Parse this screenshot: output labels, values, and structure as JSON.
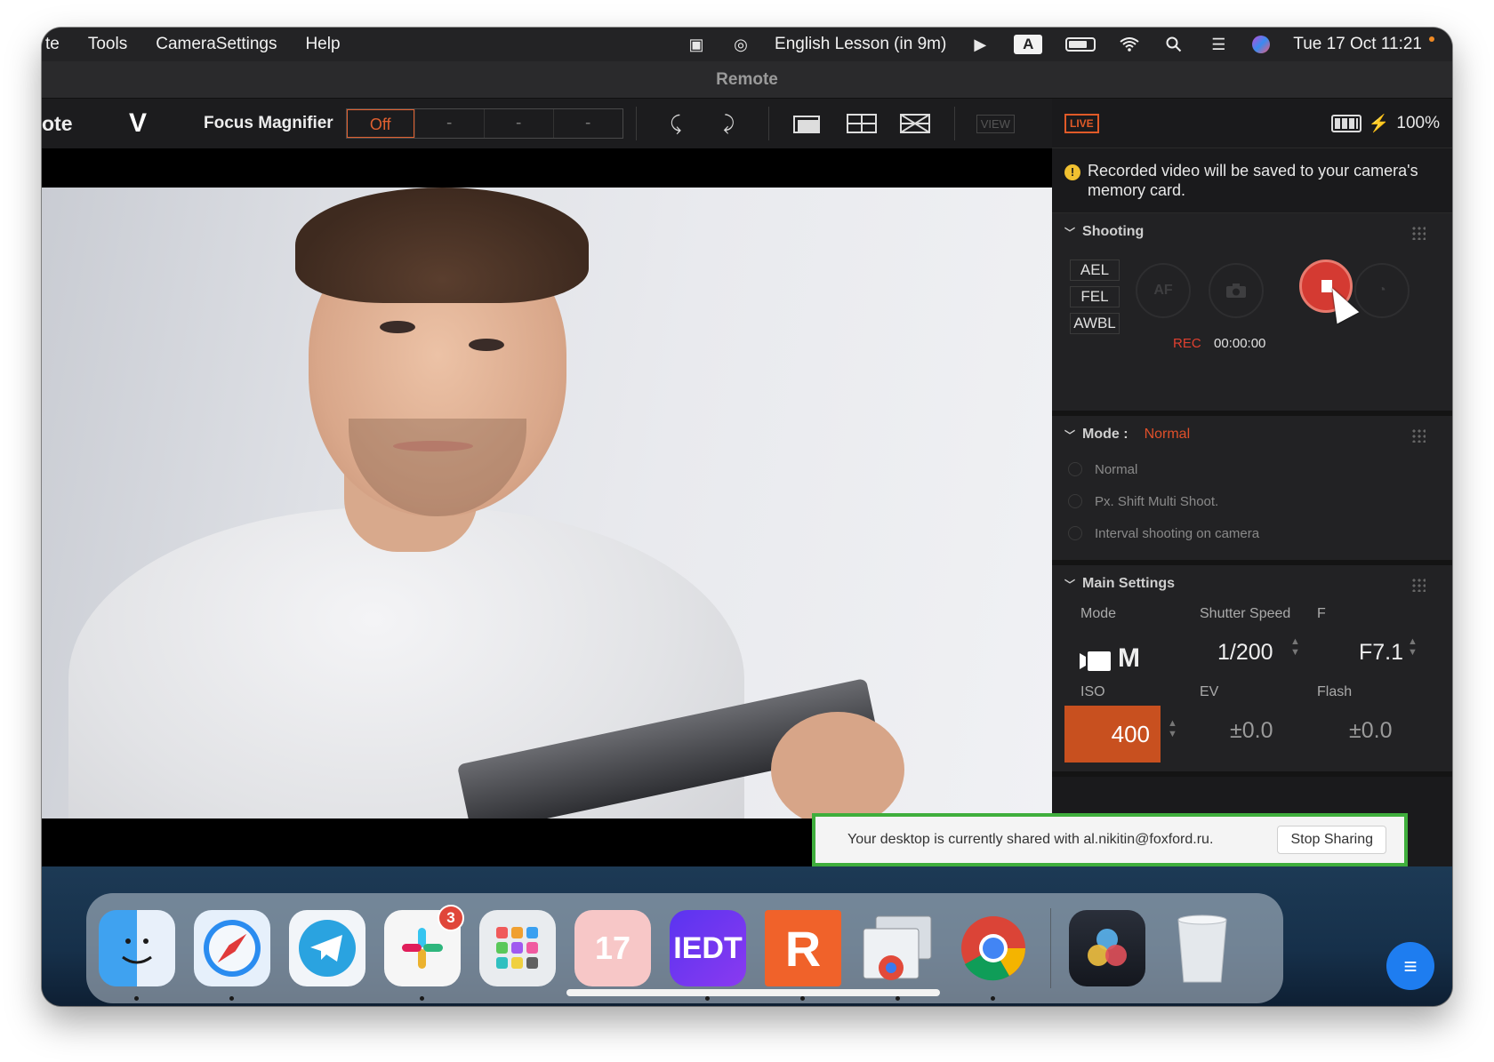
{
  "menubar": {
    "app_fragment": "te",
    "items": [
      "Tools",
      "CameraSettings",
      "Help"
    ],
    "event": "English Lesson (in 9m)",
    "input_letter": "A",
    "clock": "Tue 17 Oct  11:21",
    "icons": [
      "screen-record-icon",
      "creative-cloud-icon",
      "event-icon",
      "play-icon",
      "input-source-icon",
      "battery-icon",
      "wifi-icon",
      "search-icon",
      "control-center-icon",
      "siri-icon"
    ]
  },
  "window": {
    "title": "Remote"
  },
  "toolbar": {
    "app_name": "ote",
    "logo": "V",
    "focus_magnifier_label": "Focus Magnifier",
    "focus_magnifier_value": "Off",
    "dash_1": "-",
    "dash_2": "-",
    "dash_3": "-"
  },
  "panel": {
    "live_badge": "LIVE",
    "battery": "100%",
    "warning_icon": "!",
    "warning": "Recorded video will be saved to your camera's memory card.",
    "shooting": {
      "title": "Shooting",
      "locks": [
        "AEL",
        "FEL",
        "AWBL"
      ],
      "af_label": "AF",
      "rec_label": "REC",
      "rec_time": "00:00:00"
    },
    "mode": {
      "title": "Mode :",
      "current": "Normal",
      "options": [
        "Normal",
        "Px. Shift Multi Shoot.",
        "Interval shooting on camera"
      ]
    },
    "main_settings": {
      "title": "Main Settings",
      "mode_label": "Mode",
      "mode_value": "M",
      "shutter_label": "Shutter Speed",
      "shutter_value": "1/200",
      "f_label": "F",
      "f_value": "F7.1",
      "iso_label": "ISO",
      "iso_value": "400",
      "ev_label": "EV",
      "ev_value": "±0.0",
      "flash_label": "Flash",
      "flash_value": "±0.0"
    }
  },
  "share_banner": {
    "message": "Your desktop is currently shared with al.nikitin@foxford.ru.",
    "button": "Stop Sharing"
  },
  "dock": {
    "slack_badge": "3",
    "calendar_day": "17",
    "iedt_label": "IEDT",
    "r_label": "R",
    "apps": [
      "Finder",
      "Safari",
      "Telegram",
      "Slack",
      "Launchpad",
      "Calendar",
      "IEDT",
      "R",
      "Chrome Apps",
      "Chrome",
      "DaVinci Resolve",
      "Trash"
    ]
  },
  "colors": {
    "accent": "#e0502a",
    "rec_red": "#d43a32",
    "share_green": "#3fae3c",
    "iso_bg": "#c8501f"
  }
}
